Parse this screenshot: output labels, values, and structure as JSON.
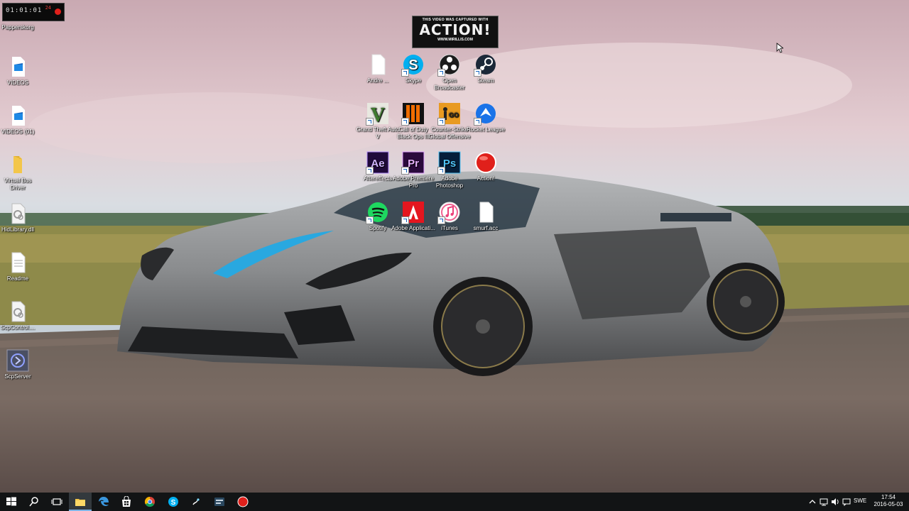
{
  "overlays": {
    "recorder": {
      "time": "01:01:01",
      "fps": "24"
    },
    "watermark": {
      "line1": "THIS VIDEO WAS CAPTURED WITH",
      "brand": "ACTION!",
      "url": "WWW.MIRILLIS.COM"
    }
  },
  "desktop_left": [
    {
      "label": "Papperskorg",
      "icon": "recycle-bin-icon"
    },
    {
      "label": "VIDEOS",
      "icon": "video-file-icon"
    },
    {
      "label": "VIDEOS (01)",
      "icon": "video-file-icon"
    },
    {
      "label": "Virtual Bus Driver",
      "icon": "folder-icon"
    },
    {
      "label": "HidLibrary.dll",
      "icon": "dll-file-icon"
    },
    {
      "label": "Readme",
      "icon": "text-file-icon"
    },
    {
      "label": "ScpControl....",
      "icon": "dll-file-icon"
    },
    {
      "label": "ScpServer",
      "icon": "scp-server-icon"
    }
  ],
  "desktop_grid": [
    {
      "label": "Andre ...",
      "icon": "text-file-icon"
    },
    {
      "label": "Skype",
      "icon": "skype-icon"
    },
    {
      "label": "Open Broadcaster",
      "icon": "obs-icon"
    },
    {
      "label": "Steam",
      "icon": "steam-icon"
    },
    {
      "label": "Grand Theft Auto V",
      "icon": "gta-icon"
    },
    {
      "label": "Call of Duty Black Ops III",
      "icon": "cod-icon"
    },
    {
      "label": "Counter-Strike Global Offensive",
      "icon": "csgo-icon"
    },
    {
      "label": "Rocket League",
      "icon": "rocket-league-icon"
    },
    {
      "label": "Aftereffects",
      "icon": "after-effects-icon"
    },
    {
      "label": "Adobe Premiere Pro",
      "icon": "premiere-icon"
    },
    {
      "label": "Adobe Photoshop",
      "icon": "photoshop-icon"
    },
    {
      "label": "Action!",
      "icon": "action-icon"
    },
    {
      "label": "Spotify",
      "icon": "spotify-icon"
    },
    {
      "label": "Adobe Applicati...",
      "icon": "adobe-icon"
    },
    {
      "label": "iTunes",
      "icon": "itunes-icon"
    },
    {
      "label": "smurf.acc",
      "icon": "text-file-icon"
    }
  ],
  "taskbar": {
    "buttons": [
      "start-icon",
      "search-icon",
      "task-view-icon",
      "file-explorer-icon",
      "edge-icon",
      "store-icon",
      "chrome-icon",
      "skype-icon",
      "obs-icon",
      "steam-icon",
      "action-icon"
    ],
    "language": "SWE",
    "time": "17:54",
    "date": "2016-05-03"
  }
}
